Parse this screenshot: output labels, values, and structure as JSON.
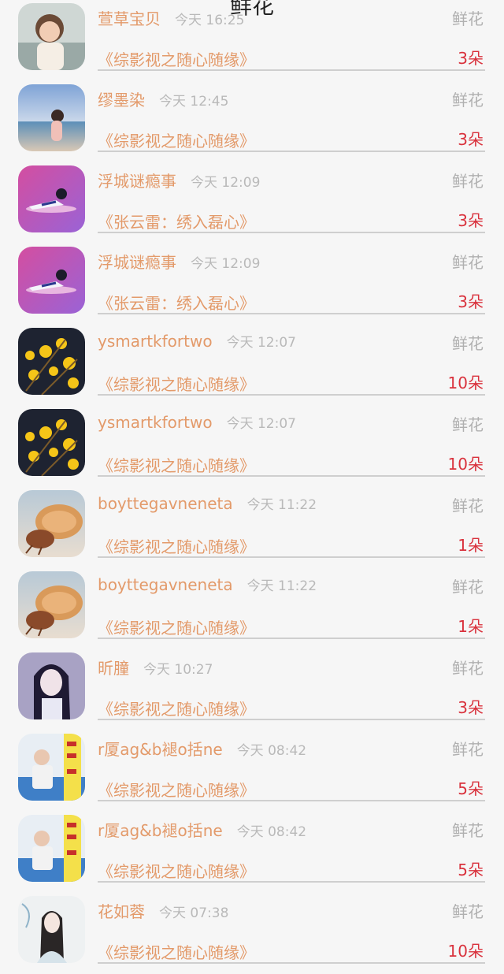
{
  "page": {
    "title": "鲜花"
  },
  "rows": [
    {
      "name": "萱草宝贝",
      "time": "今天 16:25",
      "type": "鲜花",
      "work": "《综影视之随心随缘》",
      "count": "3朵",
      "avatar": "avatar-child-photo"
    },
    {
      "name": "缪墨染",
      "time": "今天 12:45",
      "type": "鲜花",
      "work": "《综影视之随心随缘》",
      "count": "3朵",
      "avatar": "avatar-beach-girl"
    },
    {
      "name": "浮城谜瘾事",
      "time": "今天 12:09",
      "type": "鲜花",
      "work": "《张云雷：绣入磊心》",
      "count": "3朵",
      "avatar": "avatar-pink-cartoon"
    },
    {
      "name": "浮城谜瘾事",
      "time": "今天 12:09",
      "type": "鲜花",
      "work": "《张云雷：绣入磊心》",
      "count": "3朵",
      "avatar": "avatar-pink-cartoon"
    },
    {
      "name": "ysmartkfortwo",
      "time": "今天 12:07",
      "type": "鲜花",
      "work": "《综影视之随心随缘》",
      "count": "10朵",
      "avatar": "avatar-yellow-flowers"
    },
    {
      "name": "ysmartkfortwo",
      "time": "今天 12:07",
      "type": "鲜花",
      "work": "《综影视之随心随缘》",
      "count": "10朵",
      "avatar": "avatar-yellow-flowers"
    },
    {
      "name": "boyttegavneneta",
      "time": "今天 11:22",
      "type": "鲜花",
      "work": "《综影视之随心随缘》",
      "count": "1朵",
      "avatar": "avatar-hermit-crab"
    },
    {
      "name": "boyttegavneneta",
      "time": "今天 11:22",
      "type": "鲜花",
      "work": "《综影视之随心随缘》",
      "count": "1朵",
      "avatar": "avatar-hermit-crab"
    },
    {
      "name": "昕朣",
      "time": "今天 10:27",
      "type": "鲜花",
      "work": "《综影视之随心随缘》",
      "count": "3朵",
      "avatar": "avatar-anime-girl"
    },
    {
      "name": "r厦ag&b褪o括ne",
      "time": "今天 08:42",
      "type": "鲜花",
      "work": "《综影视之随心随缘》",
      "count": "5朵",
      "avatar": "avatar-poster-boy"
    },
    {
      "name": "r厦ag&b褪o括ne",
      "time": "今天 08:42",
      "type": "鲜花",
      "work": "《综影视之随心随缘》",
      "count": "5朵",
      "avatar": "avatar-poster-boy"
    },
    {
      "name": "花如蓉",
      "time": "今天 07:38",
      "type": "鲜花",
      "work": "《综影视之随心随缘》",
      "count": "10朵",
      "avatar": "avatar-ink-painting-girl"
    }
  ]
}
